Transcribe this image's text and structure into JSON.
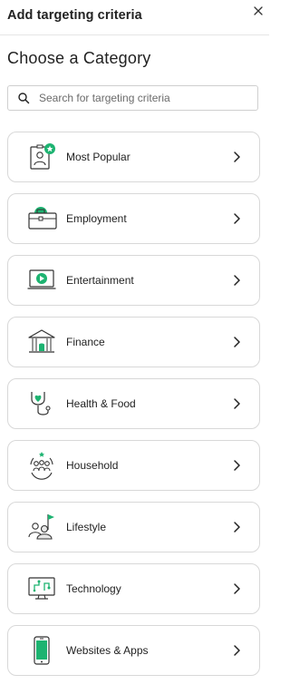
{
  "header": {
    "title": "Add targeting criteria"
  },
  "section": {
    "title": "Choose a Category"
  },
  "search": {
    "placeholder": "Search for targeting criteria"
  },
  "categories": [
    {
      "label": "Most Popular",
      "icon": "badge-star-icon"
    },
    {
      "label": "Employment",
      "icon": "briefcase-icon"
    },
    {
      "label": "Entertainment",
      "icon": "video-play-icon"
    },
    {
      "label": "Finance",
      "icon": "bank-icon"
    },
    {
      "label": "Health & Food",
      "icon": "stethoscope-heart-icon"
    },
    {
      "label": "Household",
      "icon": "family-icon"
    },
    {
      "label": "Lifestyle",
      "icon": "people-flag-icon"
    },
    {
      "label": "Technology",
      "icon": "monitor-circuit-icon"
    },
    {
      "label": "Websites & Apps",
      "icon": "smartphone-icon"
    }
  ],
  "colors": {
    "accent": "#1db371",
    "outline": "#333333",
    "border": "#d8d8d8"
  }
}
